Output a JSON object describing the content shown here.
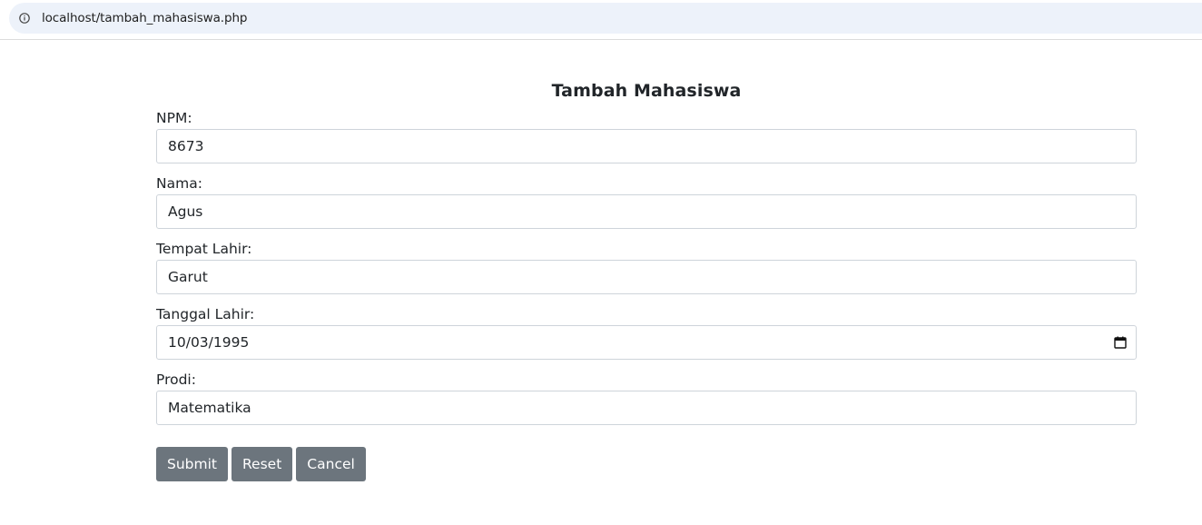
{
  "browser": {
    "url": "localhost/tambah_mahasiswa.php"
  },
  "page": {
    "title": "Tambah Mahasiswa"
  },
  "form": {
    "fields": [
      {
        "label": "NPM:",
        "value": "8673"
      },
      {
        "label": "Nama:",
        "value": "Agus"
      },
      {
        "label": "Tempat Lahir:",
        "value": "Garut"
      },
      {
        "label": "Tanggal Lahir:",
        "value": "10/03/1995"
      },
      {
        "label": "Prodi:",
        "value": "Matematika"
      }
    ],
    "buttons": {
      "submit": "Submit",
      "reset": "Reset",
      "cancel": "Cancel"
    }
  },
  "colors": {
    "button_bg": "#6c757d",
    "address_bar_bg": "#edf2fa",
    "input_border": "#ced4da"
  },
  "icons": {
    "address_bar": "info-icon",
    "date_field": "calendar-icon"
  }
}
